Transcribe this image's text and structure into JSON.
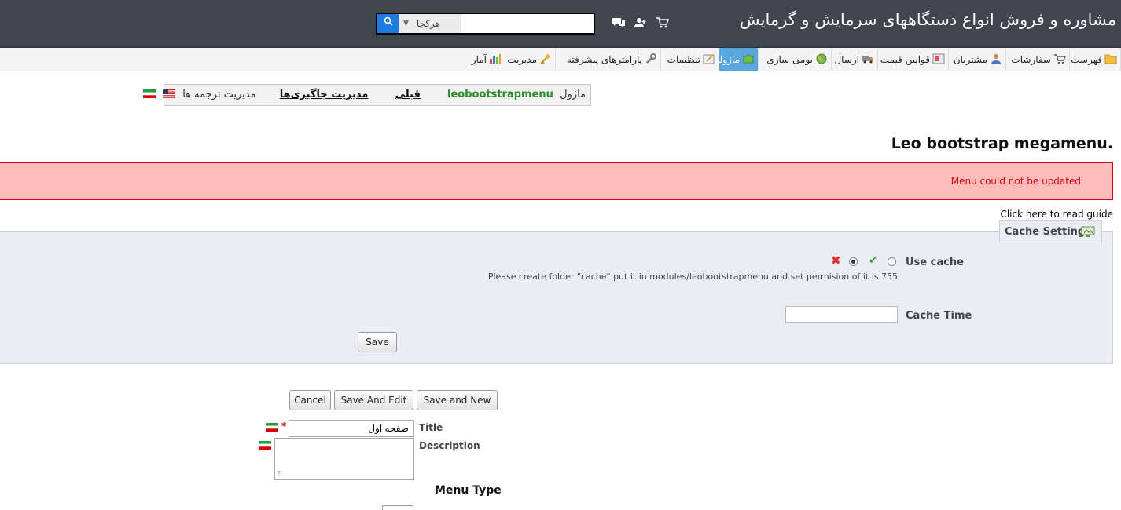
{
  "header": {
    "site_title": "مشاوره و فروش انواع دستگاههای سرمایش و گرمایش",
    "search": {
      "scope": "هرکجا",
      "placeholder": "",
      "value": ""
    },
    "icons": [
      "cart-icon",
      "users-icon",
      "chat-icon"
    ]
  },
  "tabs": [
    {
      "label": "فهرست",
      "icon": "folder-icon"
    },
    {
      "label": "سفارشات",
      "icon": "cart-icon"
    },
    {
      "label": "مشتریان",
      "icon": "user-icon"
    },
    {
      "label": "قوانین قیمت",
      "icon": "price-rules-icon"
    },
    {
      "label": "ارسال",
      "icon": "truck-icon"
    },
    {
      "label": "بومی سازی",
      "icon": "globe-icon"
    },
    {
      "label": "ماژولها",
      "icon": "puzzle-icon",
      "active": true
    },
    {
      "label": "تنظیمات",
      "icon": "settings-icon"
    },
    {
      "label": "پارامترهای پیشرفته",
      "icon": "wrench-icon"
    },
    {
      "label": "مدیریت",
      "icon": "key-icon"
    },
    {
      "label": "آمار",
      "icon": "stats-icon"
    }
  ],
  "module_bar": {
    "module_label": "ماژول",
    "module_name": "leobootstrapmenu",
    "back_link": "قبلی",
    "hooks_link": "مدیریت جاگیری‌ها",
    "translations_label": "مدیریت ترجمه ها"
  },
  "page_title": "Leo bootstrap megamenu.",
  "error_message": "Menu could not be updated",
  "guide_link": "Click here to read guide",
  "cache": {
    "legend": "Cache Setting",
    "use_cache_label": "Use cache",
    "use_cache_value": "no",
    "hint": "Please create folder \"cache\" put it in modules/leobootstrapmenu and set permision of it is 755",
    "cache_time_label": "Cache Time",
    "cache_time_value": "",
    "save_label": "Save"
  },
  "form": {
    "cancel_label": "Cancel",
    "save_edit_label": "Save And Edit",
    "save_new_label": "Save and New",
    "title_label": "Title",
    "title_value": "صفحه اول",
    "required_mark": "*",
    "description_label": "Description",
    "menu_type_label": "Menu Type"
  },
  "colors": {
    "header_bg": "#3f4650",
    "active_tab": "#5aa7dd",
    "error_bg": "#ffbaba",
    "error_text": "#d8000c",
    "panel_bg": "#ebedf4",
    "module_name": "#2d8a2d"
  }
}
